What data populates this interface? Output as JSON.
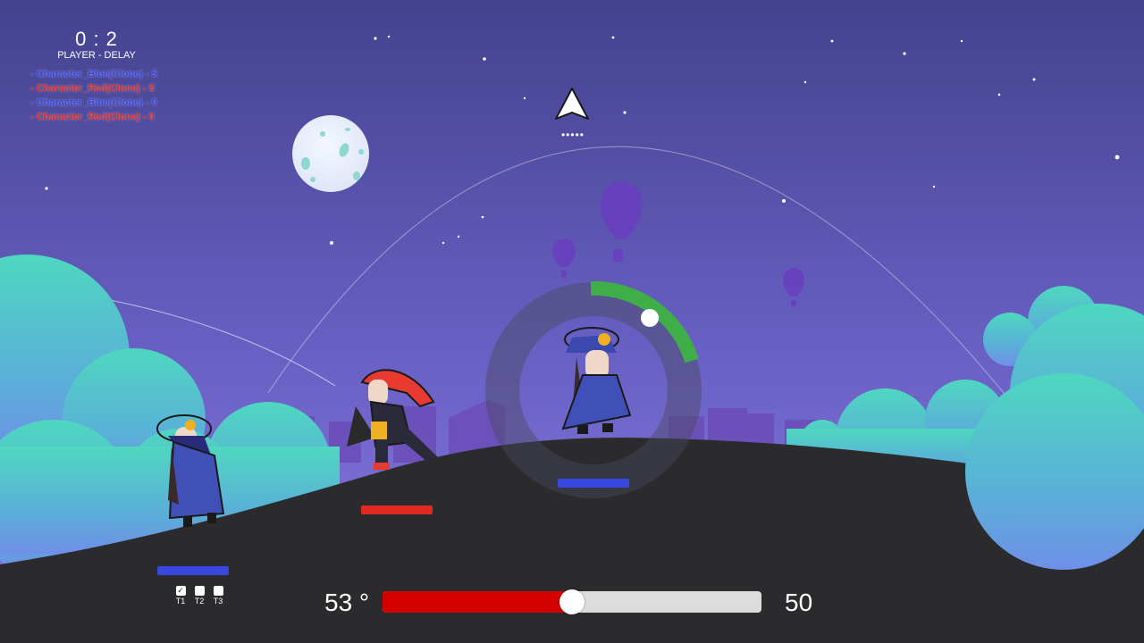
{
  "hud": {
    "score": "0 : 2",
    "mode_label": "PLAYER - DELAY",
    "killfeed": [
      {
        "text": "- Character_Blue(Clone) - 5",
        "team": "blue"
      },
      {
        "text": "- Character_Red(Clone) - 5",
        "team": "red"
      },
      {
        "text": "- Character_Blue(Clone) - 0",
        "team": "blue"
      },
      {
        "text": "- Character_Red(Clone) - 0",
        "team": "red"
      }
    ],
    "aim_indicator_dots": "•••••"
  },
  "controls": {
    "angle_label": "53 °",
    "power_label": "50",
    "power_value": 50,
    "power_max": 100
  },
  "turn_checkboxes": [
    {
      "label": "T1",
      "checked": true
    },
    {
      "label": "T2",
      "checked": false
    },
    {
      "label": "T3",
      "checked": false
    }
  ],
  "characters": [
    {
      "team": "blue",
      "role": "player-left"
    },
    {
      "team": "red",
      "role": "enemy-middle"
    },
    {
      "team": "blue",
      "role": "player-right-active"
    }
  ],
  "colors": {
    "sky_top": "#44428e",
    "sky_bottom": "#8676dc",
    "ground": "#2b2b2d",
    "blue_team": "#3848e0",
    "red_team": "#e02a20",
    "aim_arc": "#3fae49",
    "power_fill": "#d40000"
  }
}
